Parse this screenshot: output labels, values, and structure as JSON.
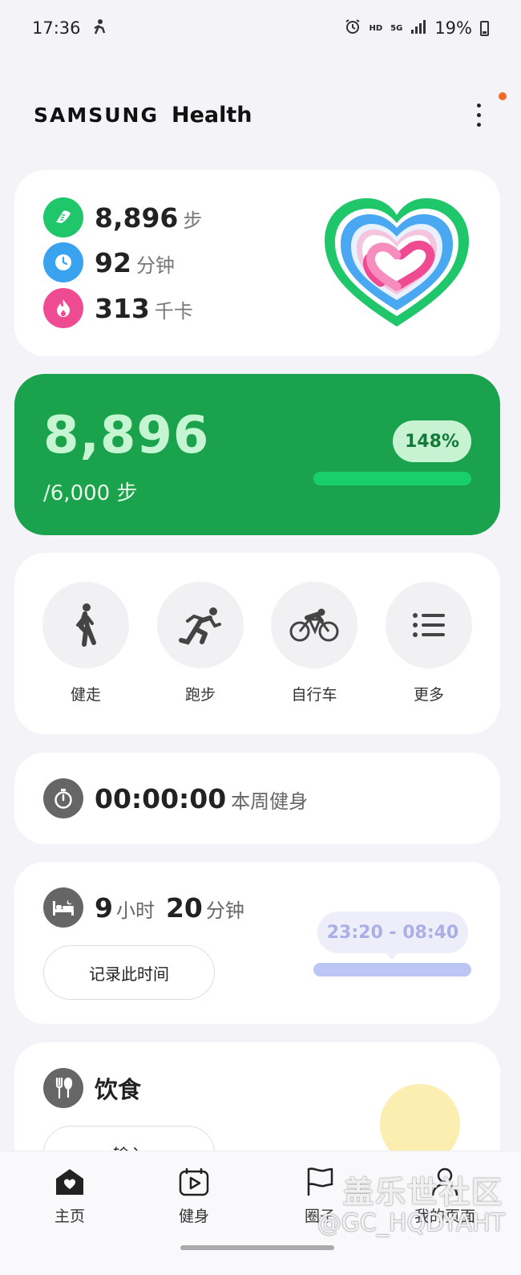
{
  "status_bar": {
    "time": "17:36",
    "net_hd": "HD",
    "net_5g": "5G",
    "battery": "19%"
  },
  "header": {
    "brand_samsung": "SAMSUNG",
    "brand_health": "Health"
  },
  "summary": {
    "steps_value": "8,896",
    "steps_unit": "步",
    "minutes_value": "92",
    "minutes_unit": "分钟",
    "calories_value": "313",
    "calories_unit": "千卡",
    "colors": {
      "steps": "#1fc76a",
      "minutes": "#3aa3ef",
      "calories": "#ef4b92"
    }
  },
  "steps_card": {
    "value": "8,896",
    "goal": "/6,000 步",
    "percent_label": "148%",
    "progress": 1.0
  },
  "shortcuts": [
    {
      "label": "健走",
      "icon": "walking-icon"
    },
    {
      "label": "跑步",
      "icon": "running-icon"
    },
    {
      "label": "自行车",
      "icon": "cycling-icon"
    },
    {
      "label": "更多",
      "icon": "list-icon"
    }
  ],
  "exercise": {
    "time": "00:00:00",
    "label": "本周健身"
  },
  "sleep": {
    "hours": "9",
    "hours_unit": "小时",
    "minutes": "20",
    "minutes_unit": "分钟",
    "record_button": "记录此时间",
    "range": "23:20 - 08:40"
  },
  "food": {
    "title": "饮食",
    "input_button": "输入"
  },
  "bottom_nav": [
    {
      "label": "主页",
      "icon": "home-icon"
    },
    {
      "label": "健身",
      "icon": "fitness-icon"
    },
    {
      "label": "圈子",
      "icon": "flag-icon"
    },
    {
      "label": "我的页面",
      "icon": "profile-icon"
    }
  ],
  "watermark": {
    "title": "盖乐世社区",
    "handle": "@GC_HQDYAHT"
  }
}
